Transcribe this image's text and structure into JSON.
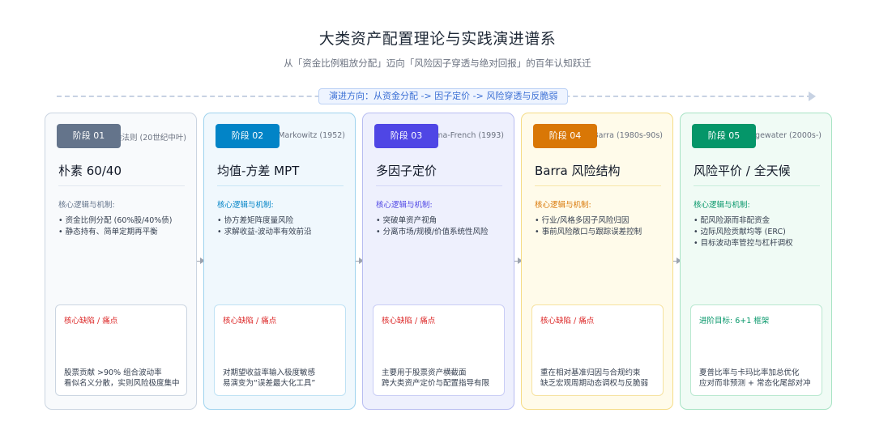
{
  "header": {
    "title": "大类资产配置理论与实践演进谱系",
    "subtitle": "从「资金比例粗放分配」迈向「风险因子穿透与绝对回报」的百年认知跃迁",
    "flow_label": "演进方向：从资金分配 -> 因子定价 -> 风险穿透与反脆弱"
  },
  "stages": [
    {
      "badge": "阶段 01",
      "period": "经验法则 (20世纪中叶)",
      "title": "朴素 60/40",
      "mech_label": "核心逻辑与机制:",
      "mechanisms": [
        "• 资金比例分配 (60%股/40%债)",
        "• 静态持有、简单定期再平衡"
      ],
      "pain_label": "核心缺陷 / 痛点",
      "pain_lines": [
        "股票贡献 >90% 组合波动率",
        "看似名义分散，实则风险极度集中"
      ],
      "colors": {
        "bg": "#f8fafc",
        "border": "#cbd5e1",
        "badge": "#64748b",
        "accent": "#64748b",
        "divider": "#e2e8f0",
        "pain_border": "#cbd5e1",
        "pain_label": "#dc2626"
      }
    },
    {
      "badge": "阶段 02",
      "period": "Markowitz (1952)",
      "title": "均值-方差 MPT",
      "mech_label": "核心逻辑与机制:",
      "mechanisms": [
        "• 协方差矩阵度量风险",
        "• 求解收益-波动率有效前沿"
      ],
      "pain_label": "核心缺陷 / 痛点",
      "pain_lines": [
        "对期望收益率输入极度敏感",
        "易演变为“误差最大化工具”"
      ],
      "colors": {
        "bg": "#f0f8fd",
        "border": "#9fd3ee",
        "badge": "#0284c7",
        "accent": "#0284c7",
        "divider": "#c9e6f6",
        "pain_border": "#bfe2f4",
        "pain_label": "#dc2626"
      }
    },
    {
      "badge": "阶段 03",
      "period": "Fama-French (1993)",
      "title": "多因子定价",
      "mech_label": "核心逻辑与机制:",
      "mechanisms": [
        "• 突破单资产视角",
        "• 分离市场/规模/价值系统性风险"
      ],
      "pain_label": "核心缺陷 / 痛点",
      "pain_lines": [
        "主要用于股票资产横截面",
        "跨大类资产定价与配置指导有限"
      ],
      "colors": {
        "bg": "#eef0fd",
        "border": "#b8bdf1",
        "badge": "#4f46e5",
        "accent": "#4f46e5",
        "divider": "#d3d6f7",
        "pain_border": "#c9cdf5",
        "pain_label": "#dc2626"
      }
    },
    {
      "badge": "阶段 04",
      "period": "MSCI Barra (1980s-90s)",
      "title": "Barra 风险结构",
      "mech_label": "核心逻辑与机制:",
      "mechanisms": [
        "• 行业/风格多因子风险归因",
        "• 事前风险敞口与跟踪误差控制"
      ],
      "pain_label": "核心缺陷 / 痛点",
      "pain_lines": [
        "重在相对基准归因与合规约束",
        "缺乏宏观周期动态调权与反脆弱"
      ],
      "colors": {
        "bg": "#fffbea",
        "border": "#f5dc86",
        "badge": "#d97706",
        "accent": "#d97706",
        "divider": "#f7e6a8",
        "pain_border": "#f6e2a0",
        "pain_label": "#dc2626"
      }
    },
    {
      "badge": "阶段 05",
      "period": "Bridgewater (2000s-)",
      "title": "风险平价 / 全天候",
      "mech_label": "核心逻辑与机制:",
      "mechanisms": [
        "• 配风险源而非配资金",
        "• 边际风险贡献均等 (ERC)",
        "• 目标波动率管控与杠杆调权"
      ],
      "pain_label": "进阶目标: 6+1 框架",
      "pain_lines": [
        "夏普比率与卡玛比率加总优化",
        "应对而非预测 + 常态化尾部对冲"
      ],
      "colors": {
        "bg": "#f0fbf5",
        "border": "#a7e3c4",
        "badge": "#059669",
        "accent": "#059669",
        "divider": "#c7eedb",
        "pain_border": "#b9e8d0",
        "pain_label": "#059669"
      }
    }
  ]
}
